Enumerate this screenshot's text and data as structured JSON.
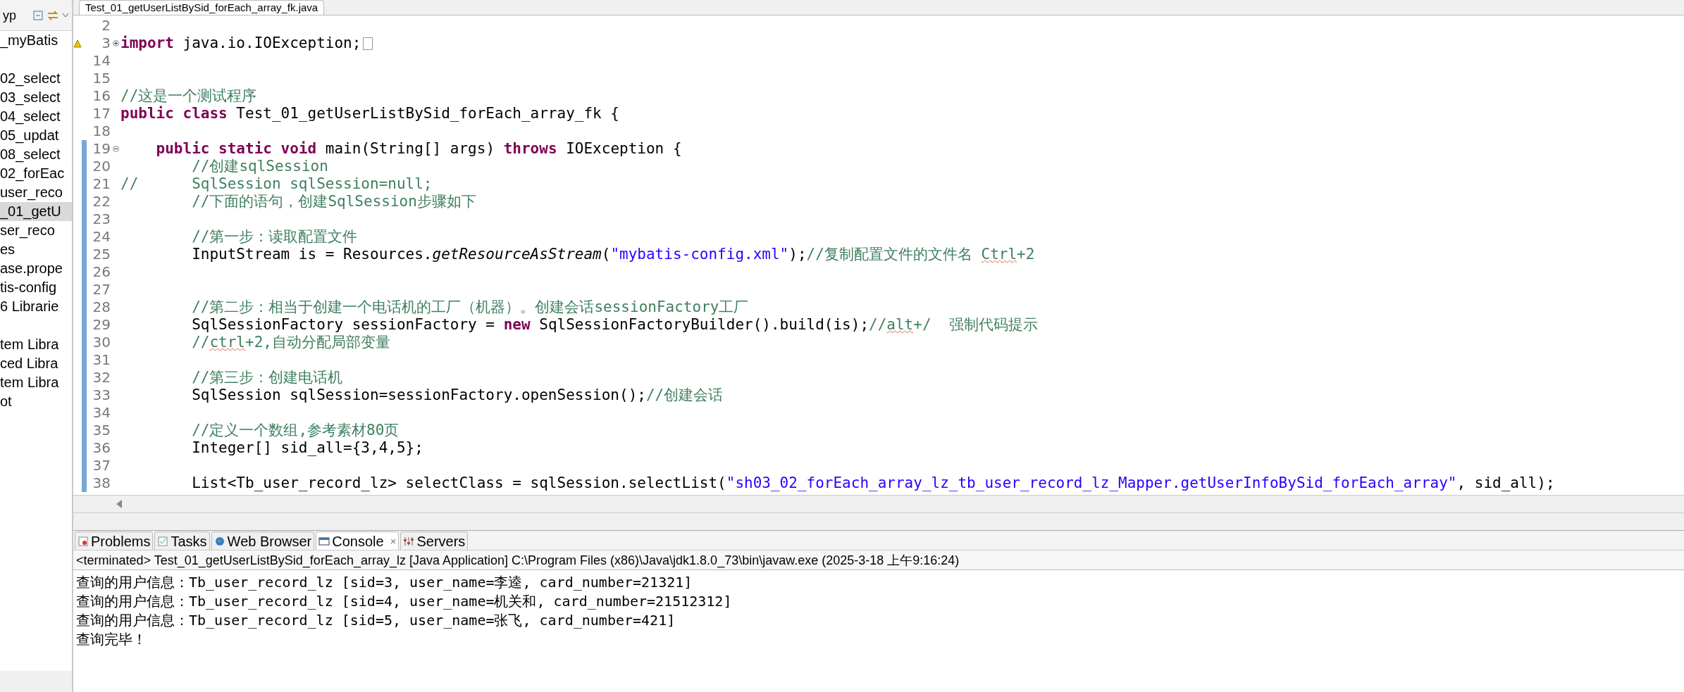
{
  "explorer": {
    "tab_label": "yp",
    "items": [
      {
        "kind": "entry",
        "label": "_myBatis",
        "selected": false
      },
      {
        "kind": "blank"
      },
      {
        "kind": "entry",
        "label": "02_select",
        "selected": false
      },
      {
        "kind": "entry",
        "label": "03_select",
        "selected": false
      },
      {
        "kind": "entry",
        "label": "04_select",
        "selected": false
      },
      {
        "kind": "entry",
        "label": "05_updat",
        "selected": false
      },
      {
        "kind": "entry",
        "label": "08_select",
        "selected": false
      },
      {
        "kind": "entry",
        "label": "02_forEac",
        "selected": false
      },
      {
        "kind": "entry",
        "label": "user_reco",
        "selected": false
      },
      {
        "kind": "entry",
        "label": "_01_getU",
        "selected": true
      },
      {
        "kind": "entry",
        "label": "ser_reco",
        "selected": false
      },
      {
        "kind": "entry",
        "label": "es",
        "selected": false
      },
      {
        "kind": "entry",
        "label": "ase.prope",
        "selected": false
      },
      {
        "kind": "entry",
        "label": "tis-config",
        "selected": false
      },
      {
        "kind": "entry",
        "label": "6 Librarie",
        "selected": false
      },
      {
        "kind": "blank"
      },
      {
        "kind": "entry",
        "label": "tem Libra",
        "selected": false
      },
      {
        "kind": "entry",
        "label": "ced Libra",
        "selected": false
      },
      {
        "kind": "entry",
        "label": "tem Libra",
        "selected": false
      },
      {
        "kind": "entry",
        "label": "ot",
        "selected": false
      }
    ]
  },
  "editor": {
    "tab_title": "Test_01_getUserListBySid_forEach_array_fk.java",
    "lines": [
      {
        "number": "2",
        "marked": false
      },
      {
        "number": "3",
        "marked": false,
        "collapsed": true,
        "warning": true,
        "tokens": [
          {
            "kind": "keyword",
            "text": "import"
          },
          {
            "kind": "plain",
            "text": " java.io.IOException;"
          }
        ]
      },
      {
        "number": "14",
        "marked": false
      },
      {
        "number": "15",
        "marked": false
      },
      {
        "number": "16",
        "marked": false,
        "tokens": [
          {
            "kind": "comment",
            "text": "//这是一个测试程序"
          }
        ]
      },
      {
        "number": "17",
        "marked": false,
        "tokens": [
          {
            "kind": "keyword",
            "text": "public"
          },
          {
            "kind": "keyword",
            "text": " class"
          },
          {
            "kind": "plain",
            "text": " Test_01_getUserListBySid_forEach_array_fk {"
          }
        ]
      },
      {
        "number": "18",
        "marked": false
      },
      {
        "number": "19",
        "marked": true,
        "collapsed": false,
        "tokens": [
          {
            "kind": "keyword",
            "text": "    public"
          },
          {
            "kind": "keyword",
            "text": " static"
          },
          {
            "kind": "keyword",
            "text": " void"
          },
          {
            "kind": "plain",
            "text": " main(String[] args) "
          },
          {
            "kind": "keyword",
            "text": "throws"
          },
          {
            "kind": "plain",
            "text": " IOException {"
          }
        ]
      },
      {
        "number": "20",
        "marked": true,
        "tokens": [
          {
            "kind": "comment",
            "text": "        //创建sqlSession"
          }
        ]
      },
      {
        "number": "21",
        "marked": true,
        "tokens": [
          {
            "kind": "comment",
            "text": "//      SqlSession sqlSession=null;"
          }
        ]
      },
      {
        "number": "22",
        "marked": true,
        "tokens": [
          {
            "kind": "comment",
            "text": "        //下面的语句，创建SqlSession步骤如下"
          }
        ]
      },
      {
        "number": "23",
        "marked": true
      },
      {
        "number": "24",
        "marked": true,
        "tokens": [
          {
            "kind": "comment",
            "text": "        //第一步：读取配置文件"
          }
        ]
      },
      {
        "number": "25",
        "marked": true,
        "tokens": [
          {
            "kind": "plain",
            "text": "        InputStream is = Resources."
          },
          {
            "kind": "static",
            "text": "getResourceAsStream"
          },
          {
            "kind": "plain",
            "text": "("
          },
          {
            "kind": "string",
            "text": "\"mybatis-config.xml\""
          },
          {
            "kind": "plain",
            "text": ");"
          },
          {
            "kind": "comment",
            "text": "//复制配置文件的文件名 "
          },
          {
            "kind": "spell",
            "text": "Ctrl"
          },
          {
            "kind": "comment",
            "text": "+2"
          }
        ]
      },
      {
        "number": "26",
        "marked": true
      },
      {
        "number": "27",
        "marked": true
      },
      {
        "number": "28",
        "marked": true,
        "tokens": [
          {
            "kind": "comment",
            "text": "        //第二步：相当于创建一个电话机的工厂（机器）。创建会话sessionFactory工厂"
          }
        ]
      },
      {
        "number": "29",
        "marked": true,
        "tokens": [
          {
            "kind": "plain",
            "text": "        SqlSessionFactory sessionFactory = "
          },
          {
            "kind": "keyword",
            "text": "new"
          },
          {
            "kind": "plain",
            "text": " SqlSessionFactoryBuilder().build(is);"
          },
          {
            "kind": "comment",
            "text": "//"
          },
          {
            "kind": "spell",
            "text": "alt"
          },
          {
            "kind": "comment",
            "text": "+/  强制代码提示"
          }
        ]
      },
      {
        "number": "30",
        "marked": true,
        "tokens": [
          {
            "kind": "comment",
            "text": "        //"
          },
          {
            "kind": "spell",
            "text": "ctrl"
          },
          {
            "kind": "comment",
            "text": "+2,自动分配局部变量"
          }
        ]
      },
      {
        "number": "31",
        "marked": true
      },
      {
        "number": "32",
        "marked": true,
        "tokens": [
          {
            "kind": "comment",
            "text": "        //第三步：创建电话机"
          }
        ]
      },
      {
        "number": "33",
        "marked": true,
        "tokens": [
          {
            "kind": "plain",
            "text": "        SqlSession sqlSession=sessionFactory.openSession();"
          },
          {
            "kind": "comment",
            "text": "//创建会话"
          }
        ]
      },
      {
        "number": "34",
        "marked": true
      },
      {
        "number": "35",
        "marked": true,
        "tokens": [
          {
            "kind": "comment",
            "text": "        //定义一个数组,参考素材80页"
          }
        ]
      },
      {
        "number": "36",
        "marked": true,
        "tokens": [
          {
            "kind": "plain",
            "text": "        Integer[] sid_all={3,4,5};"
          }
        ]
      },
      {
        "number": "37",
        "marked": true
      },
      {
        "number": "38",
        "marked": true,
        "tokens": [
          {
            "kind": "plain",
            "text": "        List<Tb_user_record_lz> selectClass = sqlSession.selectList("
          },
          {
            "kind": "string",
            "text": "\"sh03_02_forEach_array_lz_tb_user_record_lz_Mapper.getUserInfoBySid_forEach_array\""
          },
          {
            "kind": "plain",
            "text": ", sid_all);"
          }
        ]
      }
    ]
  },
  "panel": {
    "tabs": [
      {
        "label": "Problems",
        "selected": false,
        "closable": false
      },
      {
        "label": "Tasks",
        "selected": false,
        "closable": false
      },
      {
        "label": "Web Browser",
        "selected": false,
        "closable": false
      },
      {
        "label": "Console",
        "selected": true,
        "closable": true
      },
      {
        "label": "Servers",
        "selected": false,
        "closable": false
      }
    ],
    "console_title": "<terminated> Test_01_getUserListBySid_forEach_array_lz [Java Application] C:\\Program Files (x86)\\Java\\jdk1.8.0_73\\bin\\javaw.exe (2025-3-18 上午9:16:24)",
    "close_glyph": "×",
    "output": [
      "查询的用户信息：Tb_user_record_lz [sid=3, user_name=李逵, card_number=21321]",
      "查询的用户信息：Tb_user_record_lz [sid=4, user_name=机关和, card_number=21512312]",
      "查询的用户信息：Tb_user_record_lz [sid=5, user_name=张飞, card_number=421]",
      "查询完毕！"
    ]
  }
}
